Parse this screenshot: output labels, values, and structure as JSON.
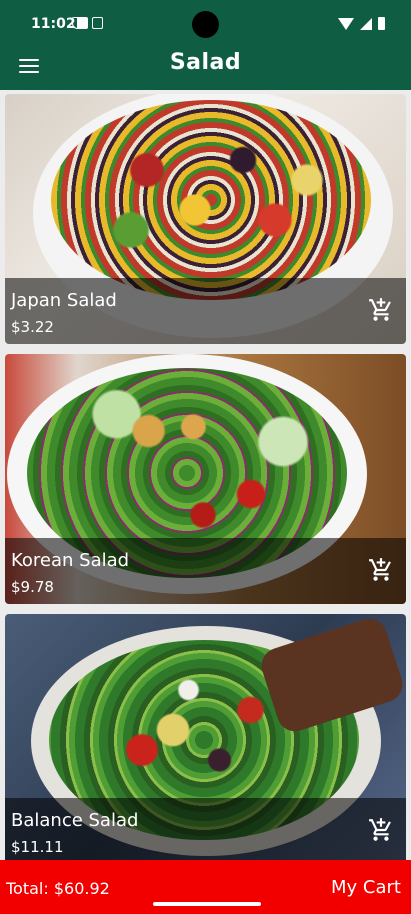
{
  "status_bar": {
    "time": "11:02"
  },
  "app_bar": {
    "title": "Salad",
    "menu_icon": "hamburger-menu-icon"
  },
  "items": [
    {
      "name": "Japan Salad",
      "price": "$3.22"
    },
    {
      "name": "Korean Salad",
      "price": "$9.78"
    },
    {
      "name": "Balance Salad",
      "price": "$11.11"
    }
  ],
  "bottom_bar": {
    "total": "Total: $60.92",
    "cart_label": "My Cart"
  },
  "colors": {
    "app_bar": "#0f5e44",
    "bottom_bar": "#f20000"
  }
}
